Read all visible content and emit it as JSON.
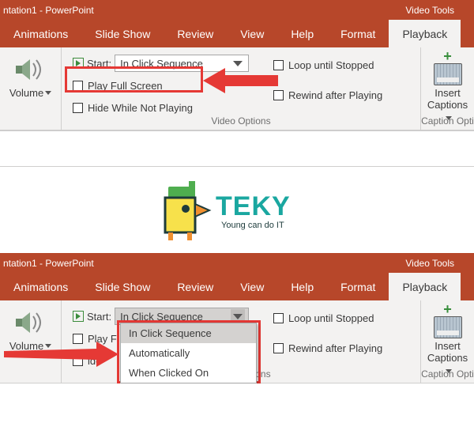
{
  "titlebar": {
    "doc": "ntation1  -  PowerPoint",
    "tools": "Video Tools"
  },
  "tabs": {
    "animations": "Animations",
    "slideshow": "Slide Show",
    "review": "Review",
    "view": "View",
    "help": "Help",
    "format": "Format",
    "playback": "Playback"
  },
  "ribbon": {
    "volume": "Volume",
    "start": "Start:",
    "start_value": "In Click Sequence",
    "play_full_screen": "Play Full Screen",
    "play_f_trunc": "Play F",
    "hide_not_playing": "Hide While Not Playing",
    "ide_trunc": "ide",
    "loop": "Loop until Stopped",
    "rewind": "Rewind after Playing",
    "video_options": "Video Options",
    "insert_captions": "Insert\nCaptions",
    "caption_options": "Caption Opti"
  },
  "dropdown": {
    "in_click": "In Click Sequence",
    "auto": "Automatically",
    "when_clicked": "When Clicked On"
  },
  "logo": {
    "brand": "TEKY",
    "tagline": "Young can do IT"
  }
}
